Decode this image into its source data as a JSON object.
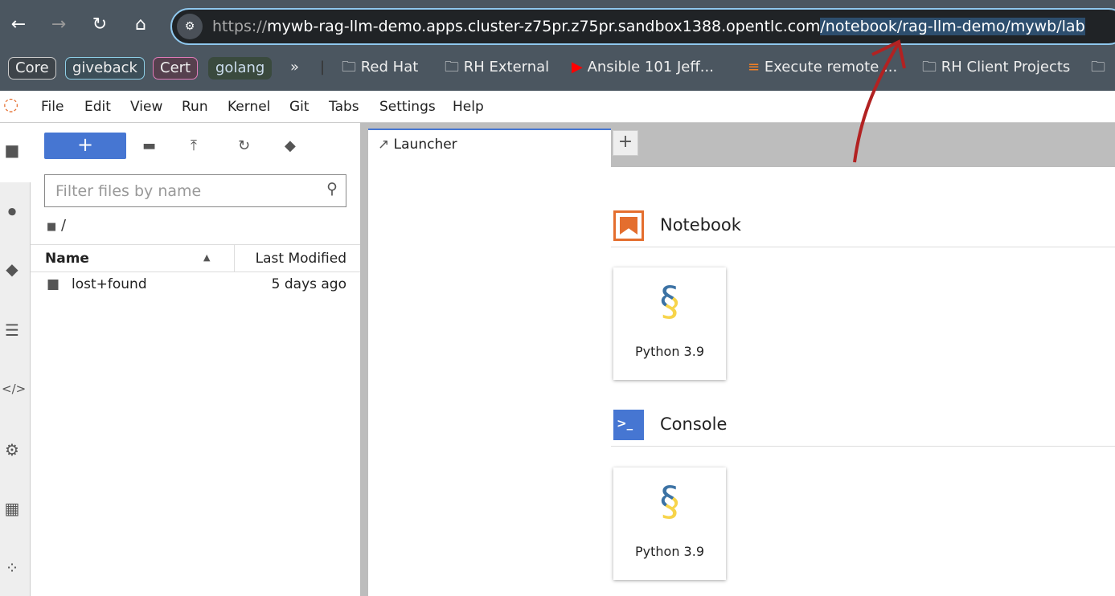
{
  "browser": {
    "url_proto": "https://",
    "url_host": "mywb-rag-llm-demo.apps.cluster-z75pr.z75pr.sandbox1388.opentlc.com",
    "url_path": "/notebook/rag-llm-demo/mywb/lab",
    "bookmarks": [
      {
        "label": "Core",
        "color": "#cccccc"
      },
      {
        "label": "giveback",
        "color": "#8fd0e8"
      },
      {
        "label": "Cert",
        "color": "#e07bb8"
      },
      {
        "label": "golang",
        "color": "#3a4a3e"
      }
    ],
    "more": "»",
    "folders": [
      "Red Hat",
      "RH External",
      "Ansible 101 Jeff...",
      "Execute remote ...",
      "RH Client Projects"
    ]
  },
  "menu": [
    "File",
    "Edit",
    "View",
    "Run",
    "Kernel",
    "Git",
    "Tabs",
    "Settings",
    "Help"
  ],
  "filebrowser": {
    "filter_placeholder": "Filter files by name",
    "path": "/",
    "col_name": "Name",
    "col_modified": "Last Modified",
    "files": [
      {
        "name": "lost+found",
        "modified": "5 days ago"
      }
    ]
  },
  "tabs": {
    "active": "Launcher"
  },
  "launcher": {
    "notebook_title": "Notebook",
    "console_title": "Console",
    "notebook_kernel": "Python 3.9",
    "console_kernel": "Python 3.9"
  },
  "colors": {
    "accent": "#4676d2",
    "annotation": "#b22222"
  }
}
